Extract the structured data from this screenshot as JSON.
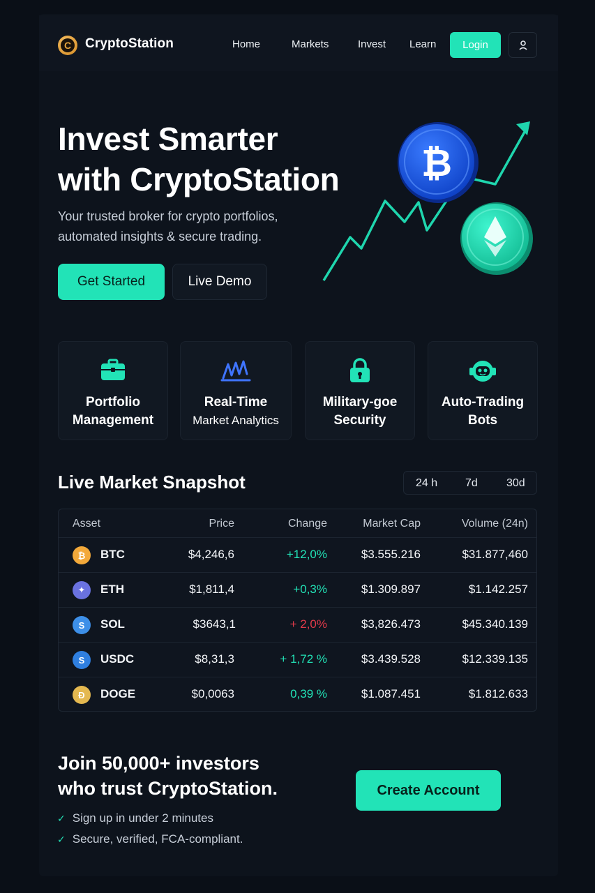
{
  "nav": {
    "brand": "CryptoStation",
    "logo_glyph": "C",
    "links": [
      "Home",
      "Markets",
      "Invest",
      "Learn"
    ],
    "login_label": "Login",
    "user_icon": "user-icon"
  },
  "hero": {
    "title_line1": "Invest Smarter",
    "title_line2": "with CryptoStation",
    "subtitle_line1": "Your trusted broker for crypto portfolios,",
    "subtitle_line2": "automated insights & secure trading.",
    "primary_cta": "Get Started",
    "secondary_cta": "Live Demo",
    "art_icons": [
      "bitcoin-coin-icon",
      "ethereum-coin-icon",
      "trend-arrow-icon"
    ]
  },
  "features": [
    {
      "icon": "briefcase-icon",
      "line1": "Portfolio",
      "line2": "Management"
    },
    {
      "icon": "analytics-chart-icon",
      "line1": "Real-Time",
      "line2": "Market Analytics"
    },
    {
      "icon": "lock-icon",
      "line1": "Military-goe",
      "line2": "Security"
    },
    {
      "icon": "robot-icon",
      "line1": "Auto-Trading",
      "line2": "Bots"
    }
  ],
  "snapshot": {
    "title": "Live Market Snapshot",
    "ranges": [
      "24 h",
      "7d",
      "30d"
    ],
    "columns": [
      "Asset",
      "Price",
      "Change",
      "Market Cap",
      "Volume (24n)"
    ],
    "rows": [
      {
        "symbol": "BTC",
        "glyph": "₿",
        "color": "#f3a93a",
        "price": "$4,246,6",
        "change": "+12,0%",
        "change_color": "#22e3b7",
        "market_cap": "$3.555.216",
        "volume": "$31.877,460"
      },
      {
        "symbol": "ETH",
        "glyph": "✦",
        "color": "#6a72e0",
        "price": "$1,811,4",
        "change": "+0,3%",
        "change_color": "#22e3b7",
        "market_cap": "$1.309.897",
        "volume": "$1.142.257"
      },
      {
        "symbol": "SOL",
        "glyph": "S",
        "color": "#3d8fe8",
        "price": "$3643,1",
        "change": "+ 2,0%",
        "change_color": "#e23a4a",
        "market_cap": "$3,826.473",
        "volume": "$45.340.139"
      },
      {
        "symbol": "USDC",
        "glyph": "S",
        "color": "#2f7fe0",
        "price": "$8,31,3",
        "change": "+ 1,72 %",
        "change_color": "#22e3b7",
        "market_cap": "$3.439.528",
        "volume": "$12.339.135"
      },
      {
        "symbol": "DOGE",
        "glyph": "Ð",
        "color": "#e4b850",
        "price": "$0,0063",
        "change": "0,39 %",
        "change_color": "#22e3b7",
        "market_cap": "$1.087.451",
        "volume": "$1.812.633"
      }
    ]
  },
  "cta": {
    "title_line1": "Join 50,000+ investors",
    "title_line2": "who trust CryptoStation.",
    "checks": [
      "Sign up in under 2 minutes",
      "Secure, verified, FCA-compliant."
    ],
    "button": "Create Account"
  },
  "colors": {
    "accent": "#22e3b7",
    "background": "#0a0f17",
    "negative": "#e23a4a"
  }
}
